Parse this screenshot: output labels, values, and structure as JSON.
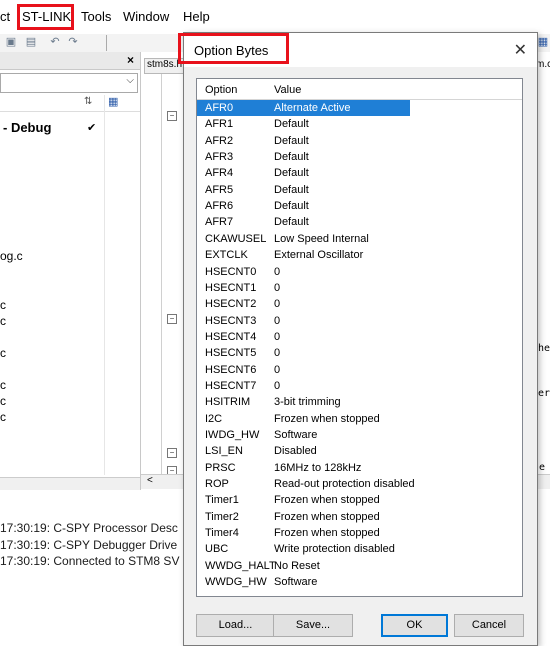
{
  "menubar": {
    "items": [
      "ct",
      "ST-LINK",
      "Tools",
      "Window",
      "Help"
    ],
    "highlight_color": "#e8111b"
  },
  "workspace": {
    "items": [
      "- Debug",
      "og.c",
      "c",
      "c",
      "c",
      "c",
      "c",
      "c"
    ],
    "checkmark": "✔"
  },
  "editor": {
    "tab_label": "stm8s.h",
    "right_tab": "m.c",
    "fragments": [
      "he",
      "er",
      "e"
    ]
  },
  "log": {
    "lines": [
      "17:30:19: C-SPY Processor Desc",
      "17:30:19: C-SPY Debugger Drive",
      "17:30:19: Connected to STM8 SV"
    ]
  },
  "dialog": {
    "title": "Option Bytes",
    "close": "✕",
    "columns": [
      "Option",
      "Value"
    ],
    "selection_color": "#1f7fd6",
    "rows": [
      {
        "option": "AFR0",
        "value": "Alternate Active",
        "selected": true
      },
      {
        "option": "AFR1",
        "value": "Default"
      },
      {
        "option": "AFR2",
        "value": "Default"
      },
      {
        "option": "AFR3",
        "value": "Default"
      },
      {
        "option": "AFR4",
        "value": "Default"
      },
      {
        "option": "AFR5",
        "value": "Default"
      },
      {
        "option": "AFR6",
        "value": "Default"
      },
      {
        "option": "AFR7",
        "value": "Default"
      },
      {
        "option": "CKAWUSEL",
        "value": "Low Speed Internal"
      },
      {
        "option": "EXTCLK",
        "value": "External Oscillator"
      },
      {
        "option": "HSECNT0",
        "value": "0"
      },
      {
        "option": "HSECNT1",
        "value": "0"
      },
      {
        "option": "HSECNT2",
        "value": "0"
      },
      {
        "option": "HSECNT3",
        "value": "0"
      },
      {
        "option": "HSECNT4",
        "value": "0"
      },
      {
        "option": "HSECNT5",
        "value": "0"
      },
      {
        "option": "HSECNT6",
        "value": "0"
      },
      {
        "option": "HSECNT7",
        "value": "0"
      },
      {
        "option": "HSITRIM",
        "value": "3-bit trimming"
      },
      {
        "option": "I2C",
        "value": "Frozen when stopped"
      },
      {
        "option": "IWDG_HW",
        "value": "Software"
      },
      {
        "option": "LSI_EN",
        "value": "Disabled"
      },
      {
        "option": "PRSC",
        "value": "16MHz to 128kHz"
      },
      {
        "option": "ROP",
        "value": "Read-out protection disabled"
      },
      {
        "option": "Timer1",
        "value": "Frozen when stopped"
      },
      {
        "option": "Timer2",
        "value": "Frozen when stopped"
      },
      {
        "option": "Timer4",
        "value": "Frozen when stopped"
      },
      {
        "option": "UBC",
        "value": "Write protection disabled"
      },
      {
        "option": "WWDG_HALT",
        "value": "No Reset"
      },
      {
        "option": "WWDG_HW",
        "value": "Software"
      }
    ],
    "buttons": {
      "load": "Load...",
      "save": "Save...",
      "ok": "OK",
      "cancel": "Cancel"
    }
  }
}
